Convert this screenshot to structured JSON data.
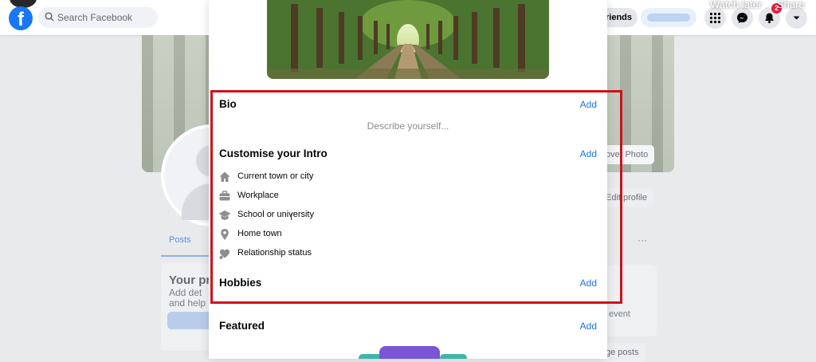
{
  "topbar": {
    "search_placeholder": "Search Facebook",
    "find_friends": "Find Friends",
    "notification_count": "2",
    "watch_later": "Watch later",
    "share": "Share"
  },
  "background": {
    "cover_photo_button": "over Photo",
    "edit_profile": "Edit profile",
    "posts_tab": "Posts",
    "more": "···",
    "your_profile_title": "Your pr",
    "your_profile_desc1": "Add det",
    "your_profile_desc2": "and help",
    "life_event": "event",
    "manage_posts": "ge posts"
  },
  "modal": {
    "bio": {
      "title": "Bio",
      "add": "Add",
      "placeholder": "Describe yourself..."
    },
    "intro": {
      "title": "Customise your Intro",
      "add": "Add",
      "items": [
        {
          "label": "Current town or city",
          "icon": "home-icon"
        },
        {
          "label": "Workplace",
          "icon": "briefcase-icon"
        },
        {
          "label": "School or university",
          "icon": "graduation-cap-icon"
        },
        {
          "label": "Home town",
          "icon": "location-pin-icon"
        },
        {
          "label": "Relationship status",
          "icon": "heart-icon"
        }
      ]
    },
    "hobbies": {
      "title": "Hobbies",
      "add": "Add"
    },
    "featured": {
      "title": "Featured",
      "add": "Add"
    }
  },
  "colors": {
    "accent": "#1b74e4",
    "brand": "#1877f2",
    "highlight": "#d0101b"
  }
}
